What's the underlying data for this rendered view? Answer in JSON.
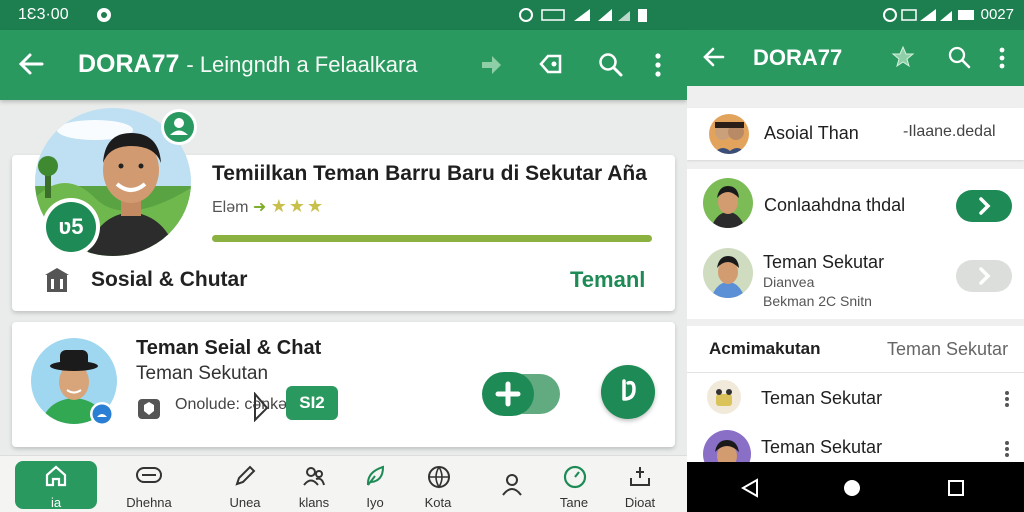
{
  "left": {
    "status": {
      "time": "1Ɛ3·00"
    },
    "appbar": {
      "title": "DORA77",
      "subtitle": "- Leingndh a Felaalkara"
    },
    "card1": {
      "heading": "Temiilkan Teman Barru Baru di Sekutar Aña",
      "meta_prefix": "Eləm",
      "rating_stars": 3,
      "progress": 1.0,
      "category_label": "Sosial & Chutar",
      "action_label": "Temanl",
      "badge_text": "ʋ5"
    },
    "card2": {
      "heading": "Teman Seial & Chat",
      "subtitle": "Teman Sekutan",
      "tags": "Onolude: cənkəus",
      "badge": "SI2"
    },
    "bottom_nav": [
      {
        "label": "ia",
        "icon": "home-icon",
        "active": true
      },
      {
        "label": "Dhehna",
        "icon": "chat-icon",
        "active": false
      },
      {
        "label": "Unea",
        "icon": "pen-icon",
        "active": false
      },
      {
        "label": "klans",
        "icon": "people-icon",
        "active": false
      },
      {
        "label": "Iyo",
        "icon": "leaf-icon",
        "active": false
      },
      {
        "label": "Kota",
        "icon": "globe-icon",
        "active": false
      },
      {
        "label": "",
        "icon": "person-icon",
        "active": false
      },
      {
        "label": "Tane",
        "icon": "clock-icon",
        "active": false
      },
      {
        "label": "Dioat",
        "icon": "share-icon",
        "active": false
      }
    ]
  },
  "right": {
    "status": {
      "time": "0027"
    },
    "appbar": {
      "title": "DORA77"
    },
    "top_row": {
      "name": "Asoial Than",
      "action": "-Ilaane.dedal"
    },
    "list": [
      {
        "name": "Conlaahdna thdal",
        "line2": "",
        "line3": ""
      },
      {
        "name": "Teman Sekutar",
        "line2": "Dianvea",
        "line3": "Bekman 2C Snitn"
      }
    ],
    "section": {
      "title": "Acmimakutan",
      "action": "Teman Sekutar"
    },
    "section_items": [
      {
        "name": "Teman Sekutar"
      },
      {
        "name": "Teman Sekutar"
      }
    ]
  },
  "colors": {
    "primary": "#2a9960",
    "primary_dark": "#1d7f50",
    "accent_green": "#1e8a55",
    "progress": "#8bb240"
  }
}
